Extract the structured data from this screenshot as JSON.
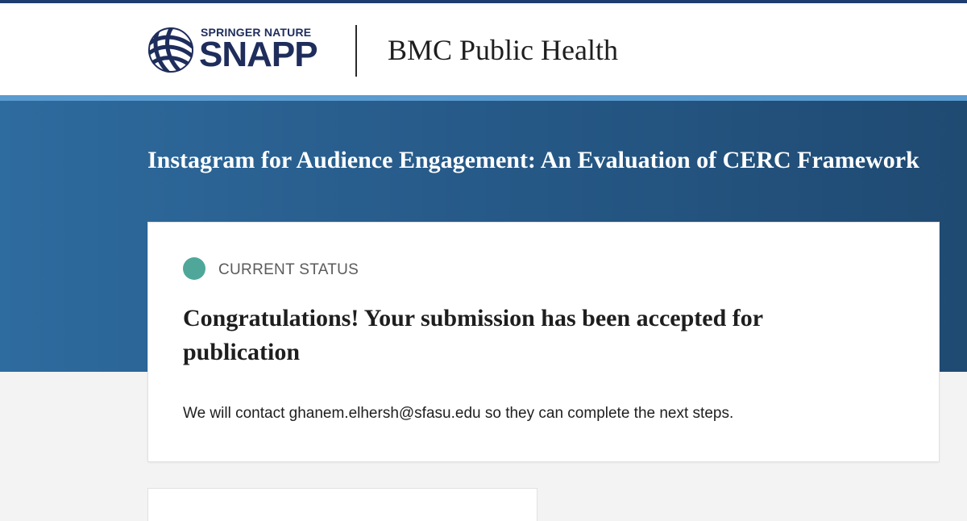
{
  "header": {
    "brand_top": "SPRINGER NATURE",
    "brand_main": "SNAPP",
    "journal_name": "BMC Public Health"
  },
  "hero": {
    "manuscript_title": "Instagram for Audience Engagement: An Evaluation of CERC Framework"
  },
  "status_card": {
    "label": "CURRENT STATUS",
    "heading": "Congratulations! Your submission has been accepted for publication",
    "message": "We will contact ghanem.elhersh@sfasu.edu so they can complete the next steps."
  },
  "colors": {
    "brand_navy": "#1f2d5c",
    "hero_blue": "#2e6b9e",
    "hero_accent": "#5a9bd0",
    "status_green": "#4fa79a"
  },
  "icons": {
    "logo_mark": "snapp-globe-icon",
    "status_indicator": "status-dot-icon"
  }
}
